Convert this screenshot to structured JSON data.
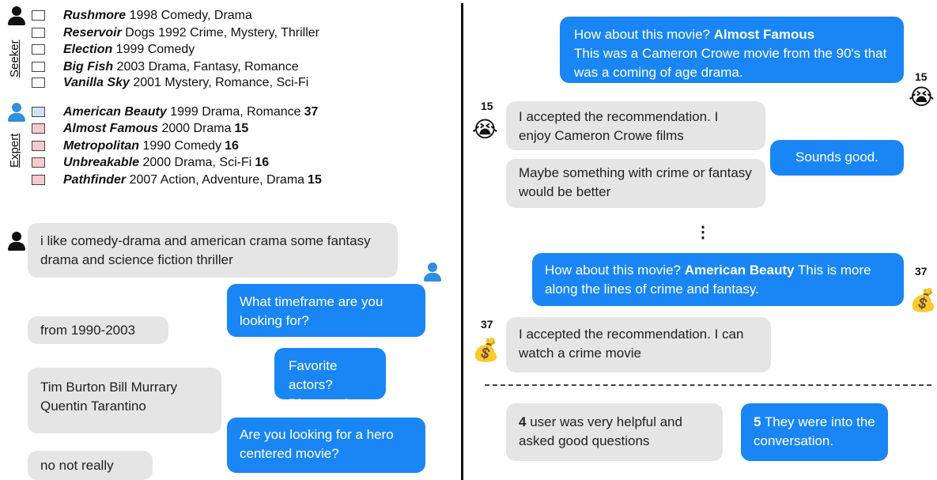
{
  "seeker_label": "Seeker",
  "expert_label": "Expert",
  "seeker_movies": [
    {
      "title": "Rushmore",
      "rest": " 1998 Comedy, Drama",
      "score": ""
    },
    {
      "title": "Reservoir",
      "rest": " Dogs 1992 Crime, Mystery, Thriller",
      "score": ""
    },
    {
      "title": "Election",
      "rest": " 1999 Comedy",
      "score": ""
    },
    {
      "title": "Big Fish",
      "rest": " 2003 Drama, Fantasy, Romance",
      "score": ""
    },
    {
      "title": "Vanilla Sky",
      "rest": " 2001 Mystery, Romance, Sci-Fi",
      "score": ""
    }
  ],
  "expert_movies": [
    {
      "title": "American Beauty",
      "rest": " 1999 Drama, Romance",
      "score": "37"
    },
    {
      "title": "Almost Famous",
      "rest": " 2000 Drama",
      "score": "15"
    },
    {
      "title": "Metropolitan",
      "rest": " 1990 Comedy",
      "score": "16"
    },
    {
      "title": "Unbreakable",
      "rest": " 2000 Drama, Sci-Fi",
      "score": "16"
    },
    {
      "title": "Pathfinder",
      "rest": " 2007 Action, Adventure, Drama",
      "score": "15"
    }
  ],
  "left_chat": {
    "m1": "i like comedy-drama and american crama some fantasy drama and science fiction thriller",
    "m2": "What timeframe are you looking for?",
    "m3": "from 1990-2003",
    "m4": "Favorite actors? Directors?",
    "m5": "Tim Burton Bill Murrary Quentin Tarantino",
    "m6": "Are you looking for a hero centered movie?",
    "m7": "no not really"
  },
  "right_chat": {
    "r1_prefix": "How about this movie? ",
    "r1_title": "Almost Famous",
    "r1_rest": "This was a Cameron Crowe movie from the 90's that was a coming of age drama.",
    "r1_score": "15",
    "r2": "I accepted the recommendation. I enjoy Cameron Crowe films",
    "r2_score": "15",
    "r3": "Sounds good.",
    "r4": "Maybe something with crime or fantasy would be better",
    "ellipsis": "⋮",
    "r5_prefix": "How about this movie? ",
    "r5_title": "American Beauty",
    "r5_rest": " This is more along the lines of crime and fantasy.",
    "r5_score": "37",
    "r6": "I accepted the recommendation. I can watch a crime movie",
    "r6_score": "37",
    "rating1_num": "4",
    "rating1_text": " user was very helpful and asked good questions",
    "rating2_num": "5",
    "rating2_text": " They were into the conversation."
  },
  "icons": {
    "seeker": "person-black-icon",
    "expert": "person-blue-icon",
    "crying": "crying-face-icon",
    "money_bag": "money-bag-icon"
  },
  "colors": {
    "expert_bubble": "#1a86f5",
    "seeker_bubble": "#e5e5e5",
    "expert_icon": "#2f8fe0"
  }
}
